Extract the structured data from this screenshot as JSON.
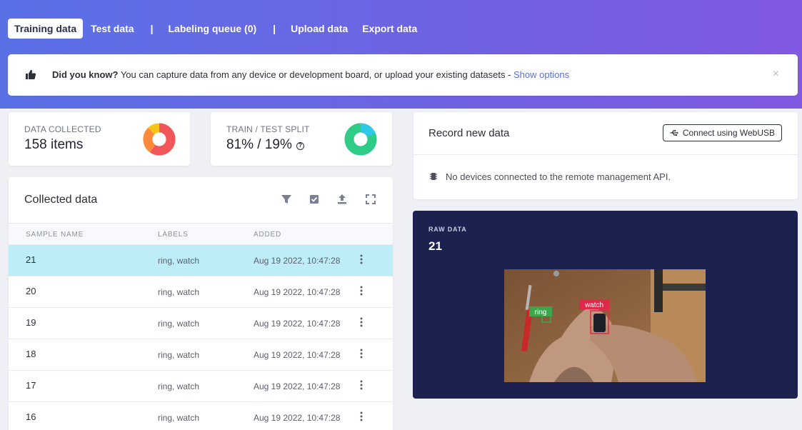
{
  "tabs": [
    {
      "label": "Training data",
      "active": true
    },
    {
      "label": "Test data",
      "active": false
    },
    {
      "label": "Labeling queue (0)",
      "active": false
    },
    {
      "label": "Upload data",
      "active": false
    },
    {
      "label": "Export data",
      "active": false
    }
  ],
  "tab_separator": "|",
  "tip": {
    "bold": "Did you know?",
    "text": " You can capture data from any device or development board, or upload your existing datasets - ",
    "link": "Show options",
    "close": "×"
  },
  "stats": {
    "collected": {
      "label": "DATA COLLECTED",
      "value": "158 items"
    },
    "split": {
      "label": "TRAIN / TEST SPLIT",
      "value": "81% / 19%",
      "help": "?",
      "train_fraction": 0.81
    }
  },
  "collected": {
    "title": "Collected data",
    "columns": [
      "SAMPLE NAME",
      "LABELS",
      "ADDED"
    ],
    "rows": [
      {
        "name": "21",
        "labels": "ring, watch",
        "added": "Aug 19 2022, 10:47:28",
        "selected": true
      },
      {
        "name": "20",
        "labels": "ring, watch",
        "added": "Aug 19 2022, 10:47:28",
        "selected": false
      },
      {
        "name": "19",
        "labels": "ring, watch",
        "added": "Aug 19 2022, 10:47:28",
        "selected": false
      },
      {
        "name": "18",
        "labels": "ring, watch",
        "added": "Aug 19 2022, 10:47:28",
        "selected": false
      },
      {
        "name": "17",
        "labels": "ring, watch",
        "added": "Aug 19 2022, 10:47:28",
        "selected": false
      },
      {
        "name": "16",
        "labels": "ring, watch",
        "added": "Aug 19 2022, 10:47:28",
        "selected": false
      }
    ]
  },
  "record": {
    "title": "Record new data",
    "connect_button": "Connect using WebUSB",
    "status": "No devices connected to the remote management API."
  },
  "raw": {
    "label": "RAW DATA",
    "value": "21",
    "boxes": [
      {
        "label": "ring",
        "color": "#3aa84a"
      },
      {
        "label": "watch",
        "color": "#e0284a"
      }
    ]
  },
  "colors": {
    "header_start": "#5a71e6",
    "header_end": "#8259e2",
    "selected_row": "#bdeef8",
    "raw_panel": "#1c2150",
    "link": "#5a6fd6"
  },
  "icons": [
    "thumbs-up-icon",
    "close-icon",
    "help-icon",
    "filter-icon",
    "checkbox-icon",
    "upload-icon",
    "expand-icon",
    "more-vertical-icon",
    "usb-icon",
    "chip-icon"
  ]
}
